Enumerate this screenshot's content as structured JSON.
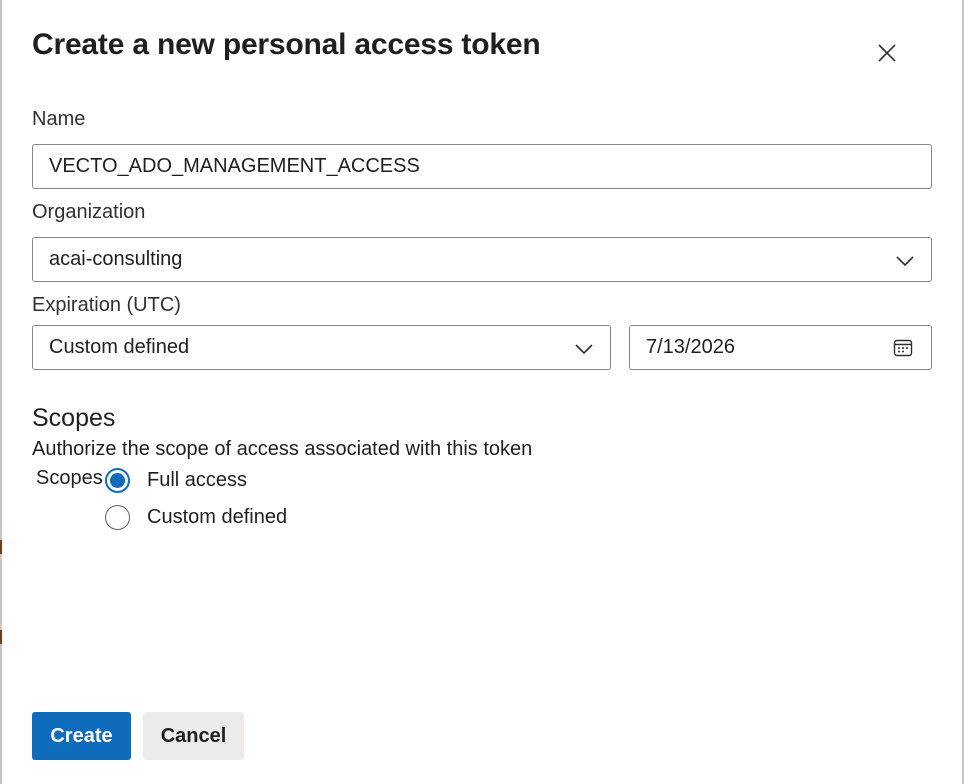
{
  "dialog": {
    "title": "Create a new personal access token",
    "close_icon": "close-icon"
  },
  "name_field": {
    "label": "Name",
    "value": "VECTO_ADO_MANAGEMENT_ACCESS"
  },
  "organization_field": {
    "label": "Organization",
    "value": "acai-consulting",
    "icon": "chevron-down-icon"
  },
  "expiration": {
    "label": "Expiration (UTC)",
    "preset_value": "Custom defined",
    "preset_icon": "chevron-down-icon",
    "date_value": "7/13/2026",
    "date_icon": "calendar-icon"
  },
  "scopes": {
    "title": "Scopes",
    "description": "Authorize the scope of access associated with this token",
    "group_label": "Scopes",
    "options": [
      {
        "label": "Full access",
        "checked": true
      },
      {
        "label": "Custom defined",
        "checked": false
      }
    ]
  },
  "actions": {
    "create_label": "Create",
    "cancel_label": "Cancel"
  },
  "colors": {
    "primary": "#0f6cbd",
    "secondary_bg": "#edebe9",
    "border": "#8a8886"
  }
}
